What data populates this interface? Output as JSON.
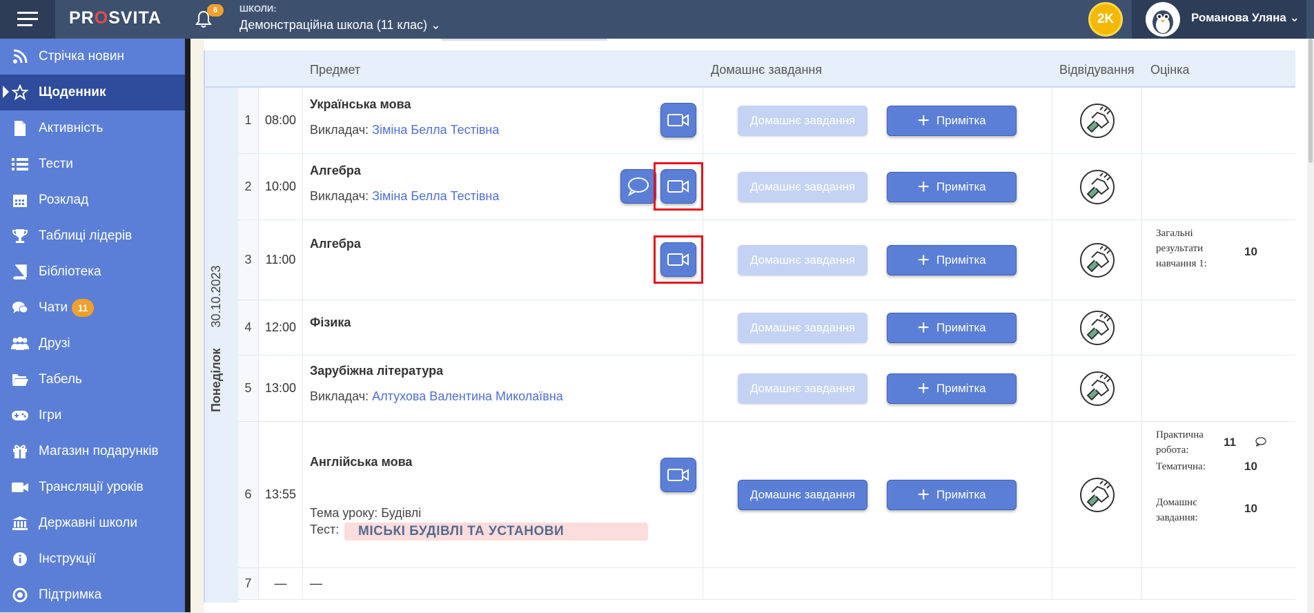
{
  "header": {
    "logo": "PROSVITA",
    "logo_o": "O",
    "notifications_count": "6",
    "school_label": "ШКОЛИ:",
    "school_name": "Демонстраційна школа (11 клас)",
    "coins": "2K",
    "user_name": "Романова Уляна"
  },
  "sidebar": {
    "items": [
      {
        "label": "Стрічка новин",
        "icon": "rss-icon"
      },
      {
        "label": "Щоденник",
        "icon": "star-icon",
        "active": true
      },
      {
        "label": "Активність",
        "icon": "document-icon"
      },
      {
        "label": "Тести",
        "icon": "list-icon"
      },
      {
        "label": "Розклад",
        "icon": "calendar-icon"
      },
      {
        "label": "Таблиці лідерів",
        "icon": "trophy-icon"
      },
      {
        "label": "Бібліотека",
        "icon": "book-icon"
      },
      {
        "label": "Чати",
        "icon": "chat-icon",
        "badge": "11"
      },
      {
        "label": "Друзі",
        "icon": "users-icon"
      },
      {
        "label": "Табель",
        "icon": "folder-icon"
      },
      {
        "label": "Ігри",
        "icon": "gamepad-icon"
      },
      {
        "label": "Магазин подарунків",
        "icon": "gift-icon"
      },
      {
        "label": "Трансляції уроків",
        "icon": "video-icon"
      },
      {
        "label": "Державні школи",
        "icon": "bank-icon"
      },
      {
        "label": "Інструкції",
        "icon": "info-icon"
      },
      {
        "label": "Підтримка",
        "icon": "support-icon"
      }
    ]
  },
  "table": {
    "headers": {
      "subject": "Предмет",
      "homework": "Домашнє завдання",
      "attendance": "Відвідування",
      "grade": "Оцінка"
    },
    "day": {
      "name": "Понеділок",
      "date": "30.10.2023"
    },
    "teacher_prefix": "Викладач:",
    "homework_label": "Домашнє завдання",
    "note_label": "Примітка",
    "rows": [
      {
        "num": "1",
        "time": "08:00",
        "subject": "Українська мова",
        "teacher": "Зіміна Белла Тестівна"
      },
      {
        "num": "2",
        "time": "10:00",
        "subject": "Алгебра",
        "teacher": "Зіміна Белла Тестівна"
      },
      {
        "num": "3",
        "time": "11:00",
        "subject": "Алгебра",
        "grade_label": "Загальні результати навчання 1:",
        "grade_value": "10"
      },
      {
        "num": "4",
        "time": "12:00",
        "subject": "Фізика"
      },
      {
        "num": "5",
        "time": "13:00",
        "subject": "Зарубіжна література",
        "teacher": "Алтухова Валентина Миколаївна"
      },
      {
        "num": "6",
        "time": "13:55",
        "subject": "Англійська мова",
        "topic": "Тема уроку: Будівлі",
        "test_label": "Тест:",
        "test_name": "МІСЬКІ БУДІВЛІ ТА УСТАНОВИ",
        "grades": [
          {
            "label": "Практична робота:",
            "value": "11"
          },
          {
            "label": "Тематична:",
            "value": "10"
          },
          {
            "label": "Домашнє завдання:",
            "value": "10"
          }
        ]
      },
      {
        "num": "7",
        "time": "—",
        "subject": "—"
      }
    ]
  },
  "colors": {
    "accent": "#5b7fd6",
    "topbar": "#3d506e",
    "highlight": "#e5121b"
  }
}
